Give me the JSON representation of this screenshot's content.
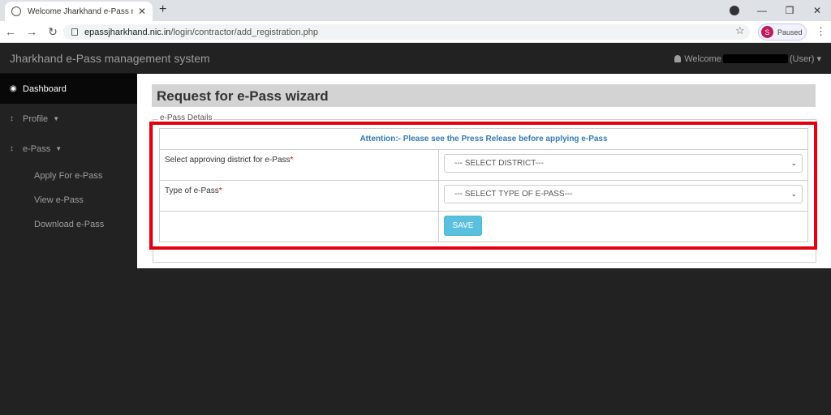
{
  "browser": {
    "tab_title": "Welcome Jharkhand e-Pass management system",
    "tab_close": "✕",
    "new_tab": "+",
    "url_host": "epassjharkhand.nic.in",
    "url_path": "/login/contractor/add_registration.php",
    "profile_initial": "S",
    "profile_status": "Paused",
    "win_min": "—",
    "win_restore": "❐",
    "win_close": "✕"
  },
  "header": {
    "brand": "Jharkhand e-Pass management system",
    "welcome_prefix": "Welcome",
    "welcome_suffix": "(User) ▾"
  },
  "sidebar": {
    "items": [
      {
        "label": "Dashboard",
        "icon": "dashboard-icon"
      },
      {
        "label": "Profile",
        "icon": "vertical-bar-icon"
      },
      {
        "label": "e-Pass",
        "icon": "vertical-bar-icon"
      }
    ],
    "subitems": [
      {
        "label": "Apply For e-Pass"
      },
      {
        "label": "View e-Pass"
      },
      {
        "label": "Download e-Pass"
      }
    ]
  },
  "form": {
    "title": "Request for e-Pass wizard",
    "legend": "e-Pass Details",
    "attention": "Attention:- Please see the Press Release before applying e-Pass",
    "district_label": "Select approving district for e-Pass",
    "district_value": "--- SELECT DISTRICT---",
    "type_label": "Type of e-Pass",
    "type_value": "--- SELECT TYPE OF E-PASS---",
    "required_mark": "*",
    "save_label": "SAVE"
  },
  "colors": {
    "highlight": "#e3000f",
    "attention_text": "#337ab7",
    "save_button": "#5bc0de"
  }
}
